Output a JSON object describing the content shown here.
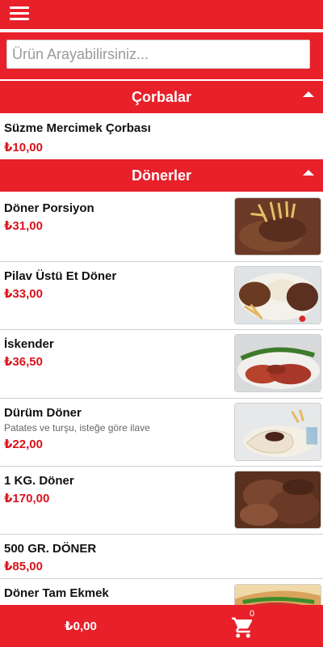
{
  "search": {
    "placeholder": "Ürün Arayabilirsiniz..."
  },
  "sections": [
    {
      "title": "Çorbalar",
      "items": [
        {
          "name": "Süzme Mercimek Çorbası",
          "price": "₺10,00"
        }
      ]
    },
    {
      "title": "Dönerler",
      "items": [
        {
          "name": "Döner Porsiyon",
          "price": "₺31,00",
          "image": "doner-portion-with-fries"
        },
        {
          "name": "Pilav Üstü Et Döner",
          "price": "₺33,00",
          "image": "doner-over-rice"
        },
        {
          "name": "İskender",
          "price": "₺36,50",
          "image": "iskender-with-peppers"
        },
        {
          "name": "Dürüm Döner",
          "desc": "Patates ve turşu, isteğe göre ilave",
          "price": "₺22,00",
          "image": "durum-wrap"
        },
        {
          "name": "1 KG. Döner",
          "price": "₺170,00",
          "image": "doner-kilo"
        },
        {
          "name": "500 GR. DÖNER",
          "price": "₺85,00"
        },
        {
          "name": "Döner Tam Ekmek",
          "price": "",
          "image": "doner-bread"
        }
      ]
    }
  ],
  "cart": {
    "total": "₺0,00",
    "count": "0"
  },
  "colors": {
    "brand": "#e8202a",
    "price": "#d9141c"
  },
  "icons": {
    "menu": "hamburger-menu-icon",
    "collapse": "caret-up-icon",
    "cart": "shopping-cart-icon"
  }
}
